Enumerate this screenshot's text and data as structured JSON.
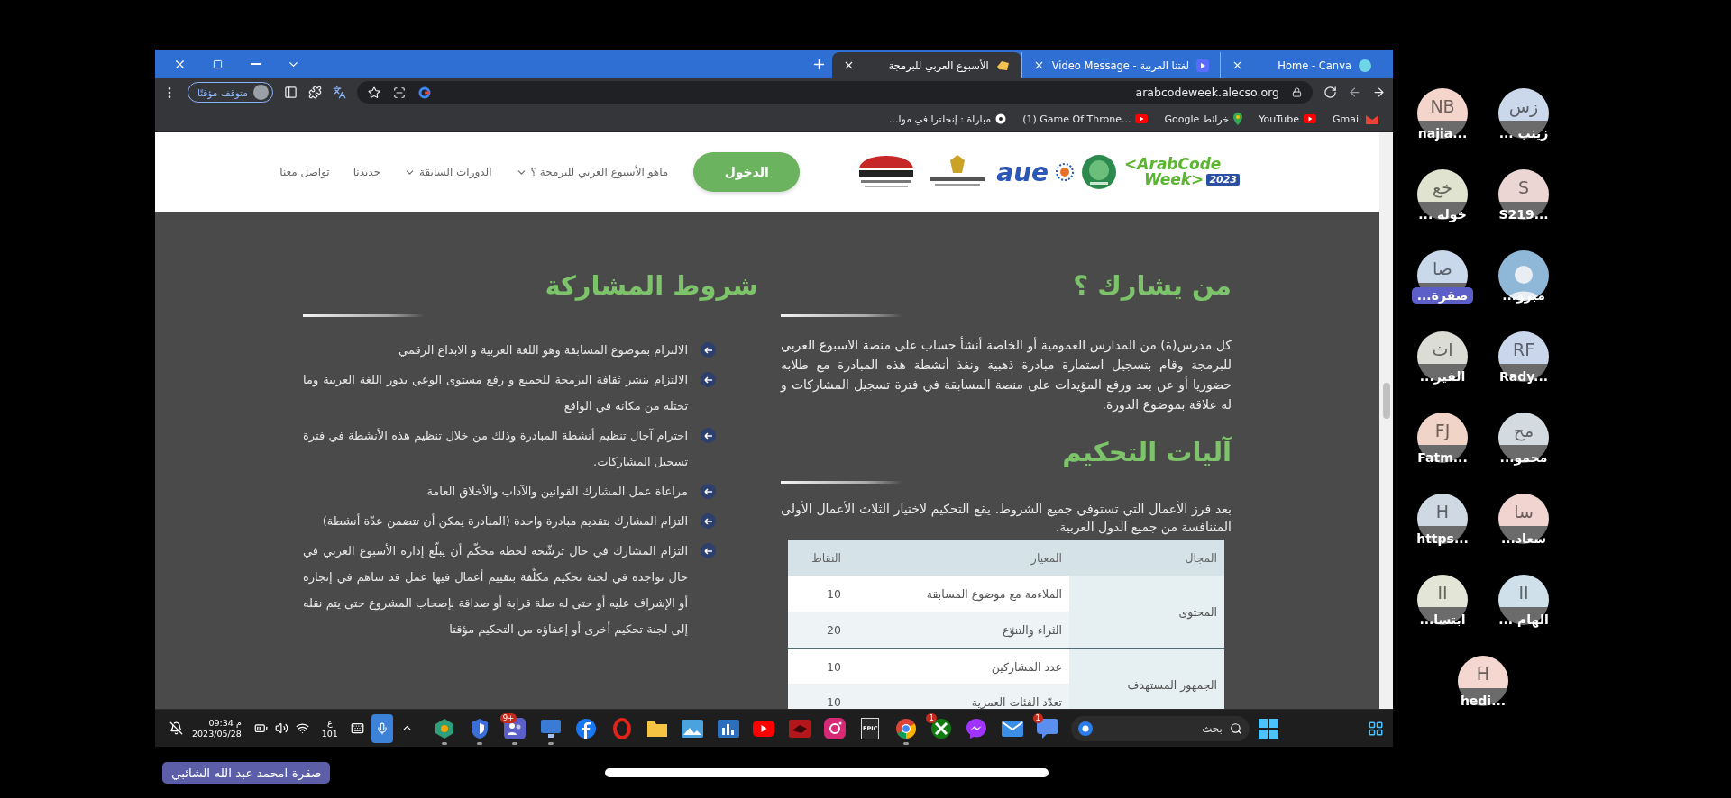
{
  "browser": {
    "tabs": [
      {
        "title": "Home - Canva",
        "kind": "design",
        "selected": false
      },
      {
        "title": "لغتنا العربية - Video Message",
        "kind": "video",
        "selected": false
      },
      {
        "title": "الأسبوع العربي للبرمجة",
        "kind": "site",
        "selected": true
      }
    ],
    "profile_chip": "متوقف مؤقتًا",
    "url": "arabcodeweek.alecso.org",
    "bookmarks": [
      {
        "label": "Gmail",
        "kind": "mail"
      },
      {
        "label": "YouTube",
        "kind": "video"
      },
      {
        "label": "خرائط Google",
        "kind": "map"
      },
      {
        "label": "(1) Game Of Throne...",
        "kind": "video"
      },
      {
        "label": "مباراة : إنجلترا في موا...",
        "kind": "sport"
      }
    ]
  },
  "site_header": {
    "logo": {
      "line1": "<ArabCode",
      "line2": "Week>",
      "year": "2023"
    },
    "partner_logo": "aue",
    "login_button": "الدخول",
    "nav": [
      {
        "label": "ماهو الأسبوع العربي للبرمجة ؟",
        "dropdown": true
      },
      {
        "label": "الدورات السابقة",
        "dropdown": true
      },
      {
        "label": "جديدنا",
        "dropdown": false
      },
      {
        "label": "تواصل معنا",
        "dropdown": false
      }
    ]
  },
  "who_participates": {
    "title": "من يشارك ؟",
    "text": "كل مدرس(ة) من المدارس العمومية أو الخاصة أنشأ حساب على منصة الاسبوع العربي للبرمجة وقام بتسجيل استمارة مبادرة ذهبية ونفذ أنشطة هذه المبادرة مع طلابه حضوريا أو عن بعد ورفع المؤيدات على منصة المسابقة في فترة تسجيل المشاركات و له علاقة بموضوع الدورة."
  },
  "judging": {
    "title": "آليات التحكيم",
    "text": "بعد فرز الأعمال التي تستوفي جميع الشروط. يقع التحكيم لاختيار الثلاث الأعمال الأولى المتنافسة من جميع الدول العربية.",
    "table": {
      "columns": [
        "المجال",
        "المعيار",
        "النقاط"
      ],
      "groups": [
        {
          "domain": "المحتوى",
          "rows": [
            {
              "criterion": "الملاءمة مع موضوع المسابقة",
              "points": "10"
            },
            {
              "criterion": "الثراء والتنوّع",
              "points": "20"
            }
          ]
        },
        {
          "domain": "الجمهور المستهدف",
          "rows": [
            {
              "criterion": "عدد المشاركين",
              "points": "10"
            },
            {
              "criterion": "تعدّد الفئات العمرية",
              "points": "10"
            }
          ]
        }
      ]
    }
  },
  "conditions": {
    "title": "شروط المشاركة",
    "items": [
      "الالتزام بموضوع المسابقة وهو اللغة العربية و الابداع الرقمي",
      "الالتزام بنشر ثقافة البرمجة للجميع و رفع مستوى الوعي بدور اللغة العربية وما تحتله من مكانة في الواقع",
      "احترام آجال تنظيم أنشطة المبادرة وذلك من خلال تنظيم هذه الأنشطة في فترة تسجيل المشاركات.",
      "مراعاة عمل المشارك القوانين والآداب والأخلاق العامة",
      "التزام المشارك بتقديم مبادرة واحدة (المبادرة يمكن أن تتضمن عدّة أنشطة)",
      "التزام المشارك في حال ترشّحه لخطة محكّم أن يبلّغ إدارة الأسبوع العربي في حال تواجده في لجنة تحكيم مكلّفة بتقييم أعمال فيها عمل قد ساهم في إنجازه أو الإشراف عليه أو حتى له صلة قرابة أو صداقة بإصحاب المشروع حتى يتم نقله إلى لجنة تحكيم أخرى أو إعفاؤه من التحكيم مؤقتا"
    ]
  },
  "taskbar": {
    "time": "09:34 م",
    "date": "2023/05/28",
    "language": "ع",
    "language_code": "101",
    "search_placeholder": "بحث",
    "apps": [
      {
        "kind": "message",
        "running": false,
        "badge": "1"
      },
      {
        "kind": "mail",
        "running": false
      },
      {
        "kind": "messenger",
        "running": false
      },
      {
        "kind": "gamepad",
        "running": false,
        "badge": "1"
      },
      {
        "kind": "browser",
        "running": true
      },
      {
        "kind": "store",
        "label": "EPIC",
        "running": false
      },
      {
        "kind": "camera",
        "running": false
      },
      {
        "kind": "device",
        "running": false
      },
      {
        "kind": "play",
        "running": false
      },
      {
        "kind": "chart",
        "running": false
      },
      {
        "kind": "photo",
        "running": false
      },
      {
        "kind": "folder",
        "running": false
      },
      {
        "kind": "ring",
        "running": false
      },
      {
        "kind": "disc",
        "running": false
      },
      {
        "kind": "monitor",
        "running": true
      },
      {
        "kind": "people",
        "running": true,
        "badge": "9+"
      },
      {
        "kind": "shield",
        "running": true
      },
      {
        "kind": "hexagon",
        "running": true
      }
    ]
  },
  "participants": [
    {
      "initials": "زس",
      "name": "زينب ...",
      "color": "#cbd7ea",
      "kind": "initials",
      "highlighted": false
    },
    {
      "initials": "NB",
      "name": "najia...",
      "color": "#f3d5cc",
      "kind": "initials",
      "highlighted": false
    },
    {
      "initials": "S",
      "name": "S219...",
      "color": "#ecd6d3",
      "kind": "initials",
      "highlighted": false
    },
    {
      "initials": "خع",
      "name": "خولة ...",
      "color": "#dfe3cf",
      "kind": "initials",
      "highlighted": false
    },
    {
      "name": "مبرو...",
      "color": "#8fb7d8",
      "kind": "photo",
      "highlighted": false
    },
    {
      "initials": "صا",
      "name": "صقرة...",
      "color": "#c9d8ea",
      "kind": "initials",
      "highlighted": true
    },
    {
      "initials": "RF",
      "name": "Rady...",
      "color": "#c9d6ec",
      "kind": "initials",
      "highlighted": false
    },
    {
      "initials": "اث",
      "name": "الفيز...",
      "color": "#dcdcd6",
      "kind": "initials",
      "highlighted": false
    },
    {
      "initials": "مح",
      "name": "محمو...",
      "color": "#d3dbe0",
      "kind": "initials",
      "highlighted": false
    },
    {
      "initials": "FJ",
      "name": "Fatm...",
      "color": "#f1d4c8",
      "kind": "initials",
      "highlighted": false
    },
    {
      "initials": "سا",
      "name": "سعاد...",
      "color": "#f1d3d0",
      "kind": "initials",
      "highlighted": false
    },
    {
      "initials": "H",
      "name": "https...",
      "color": "#cfd9e4",
      "kind": "initials",
      "highlighted": false
    },
    {
      "initials": "II",
      "name": "الهام ...",
      "color": "#cfe0ea",
      "kind": "initials",
      "highlighted": false
    },
    {
      "initials": "II",
      "name": "ابتسا...",
      "color": "#e3e6d6",
      "kind": "initials",
      "highlighted": false
    },
    {
      "initials": "H",
      "name": "hedi...",
      "color": "#f3d7d0",
      "kind": "initials",
      "highlighted": false
    }
  ],
  "presenter_name": "صقرة امحمد عبد الله الشائبي"
}
